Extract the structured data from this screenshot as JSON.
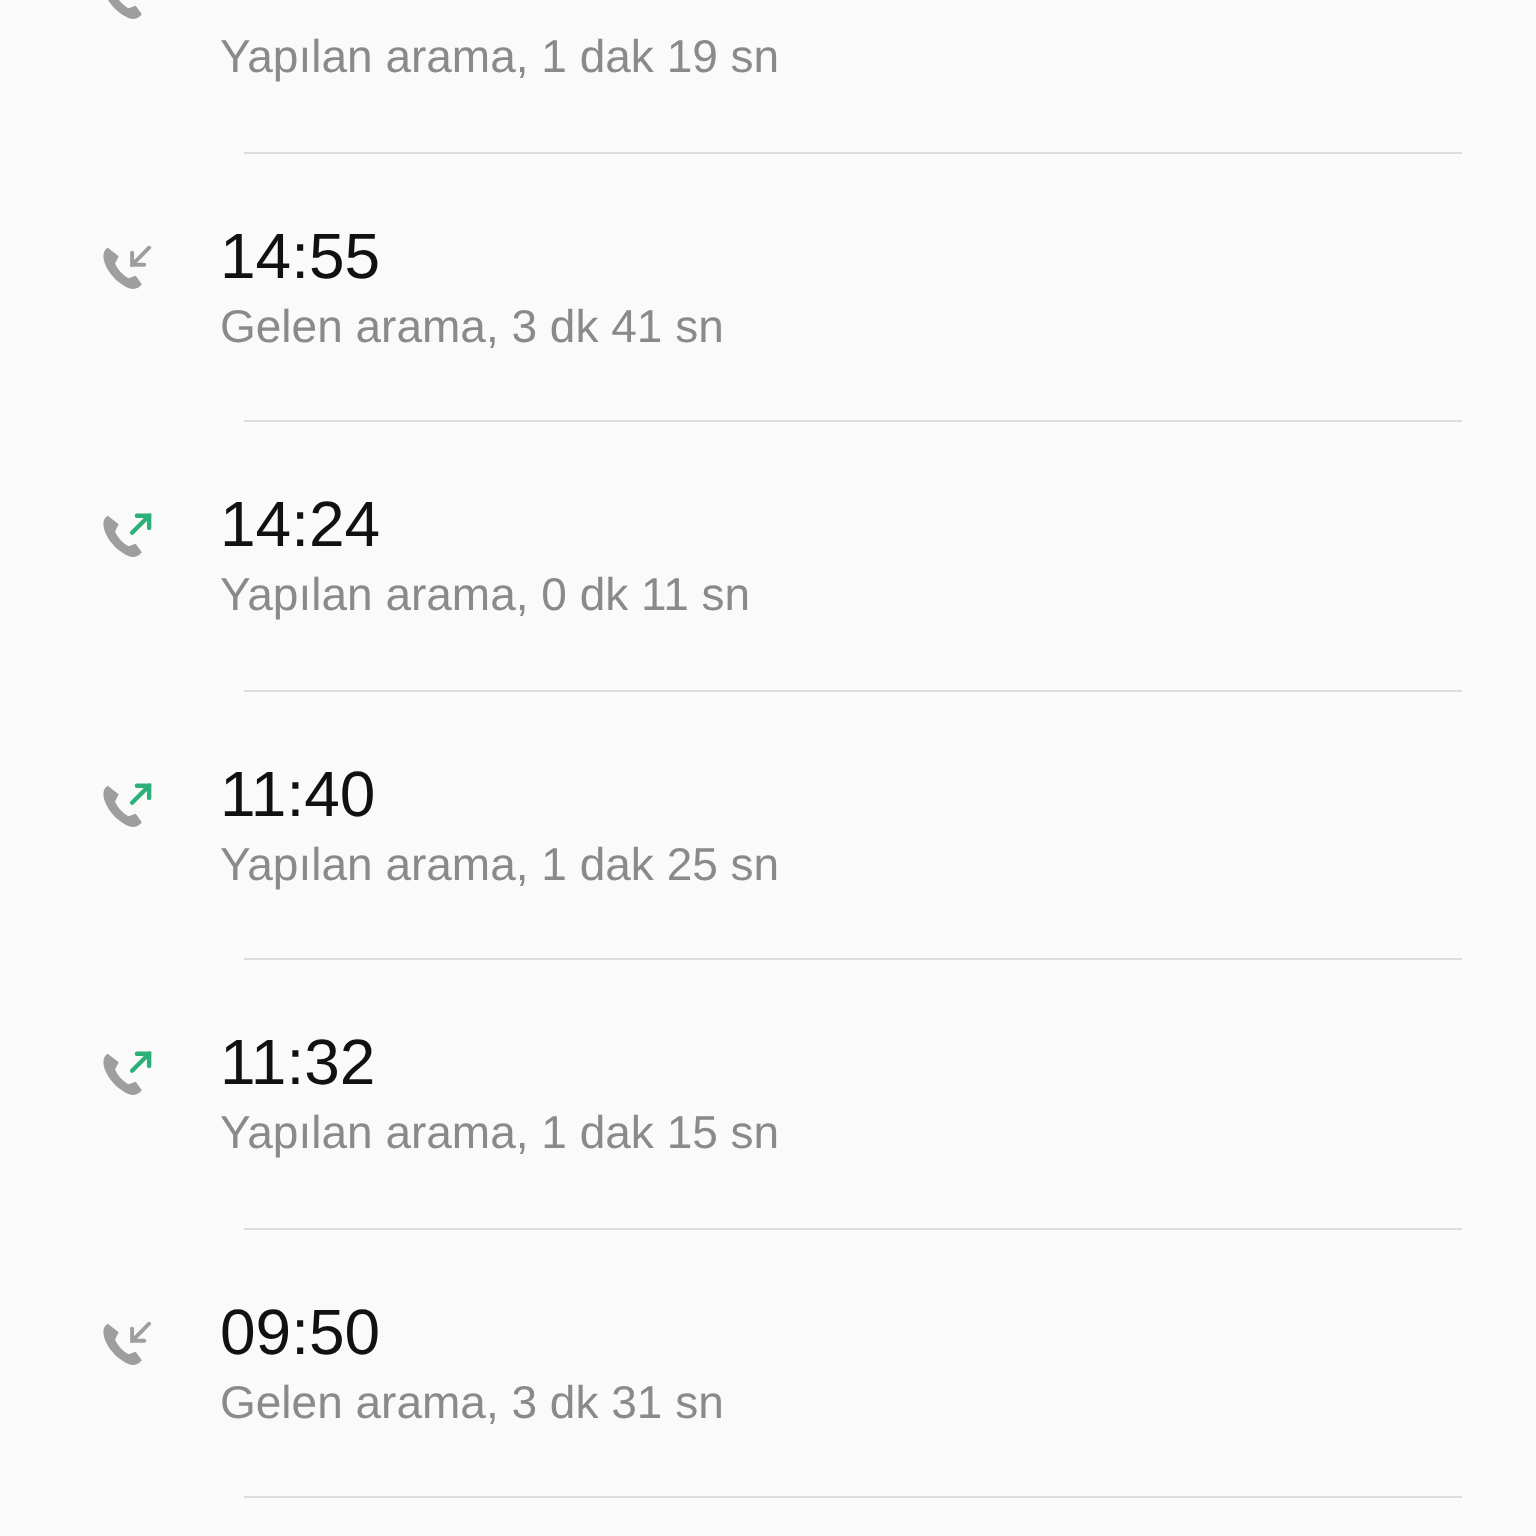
{
  "calls": [
    {
      "kind": "outgoing",
      "detail": "Yapılan arama, 1 dak 19 sn"
    },
    {
      "kind": "incoming",
      "time": "14:55",
      "detail": "Gelen arama, 3 dk 41 sn"
    },
    {
      "kind": "outgoing",
      "time": "14:24",
      "detail": "Yapılan arama, 0 dk 11 sn"
    },
    {
      "kind": "outgoing",
      "time": "11:40",
      "detail": "Yapılan arama, 1 dak 25 sn"
    },
    {
      "kind": "outgoing",
      "time": "11:32",
      "detail": "Yapılan arama, 1 dak 15 sn"
    },
    {
      "kind": "incoming",
      "time": "09:50",
      "detail": "Gelen arama, 3 dk 31 sn"
    }
  ]
}
